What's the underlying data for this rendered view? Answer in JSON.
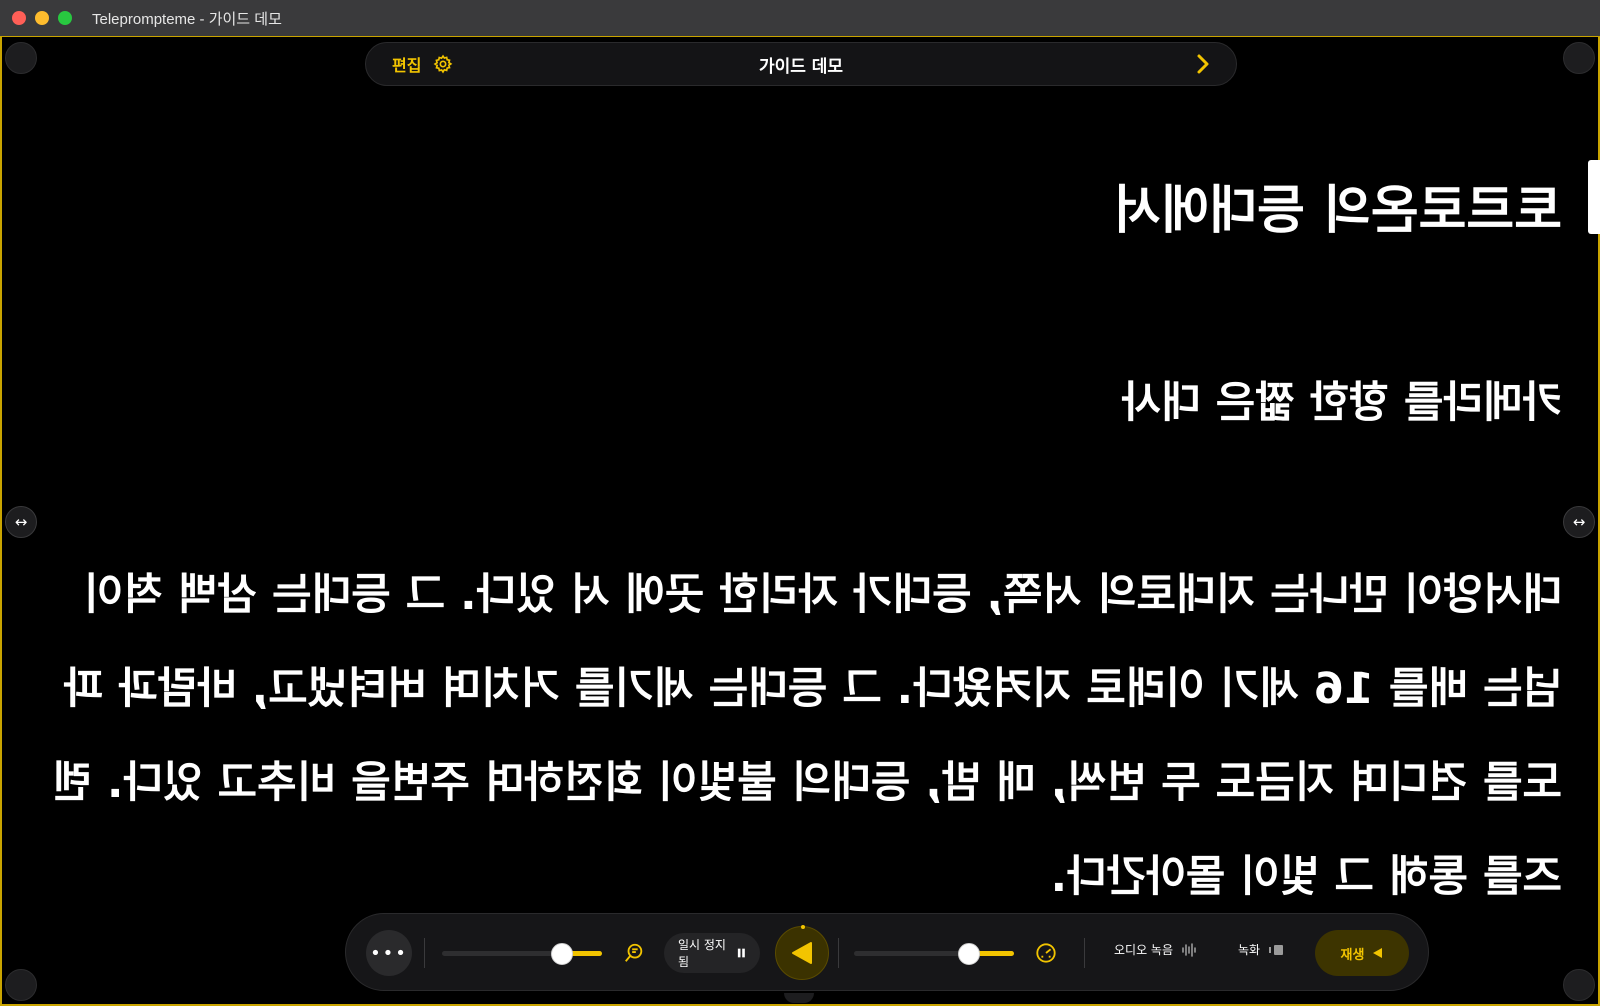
{
  "window": {
    "title": "Teleprompteme - 가이드 데모"
  },
  "topbar": {
    "edit_label": "편집",
    "script_title": "가이드 데모"
  },
  "script": {
    "mirrored": true,
    "heading": "토르로온의 등대에서",
    "subheading": "카메라를 향한 짧은 대사",
    "body": "대서양이 만나는 지대로의 서쪽, 등대가 자리한 곳에 서 있다. 그 등대는 삼백 척이 넘는 배를 16 세기 이래로 지켜왔다. 그 등대는 세기를 거치며 버텨냈고, 바람과 파도를 견디며 지금도 두 번씩, 매 밤, 등대의 불빛이 회전하며 주변을 비추고 있다. 렌즈를 통해 그 빛이 몰아간다."
  },
  "controls": {
    "more_label": "•••",
    "paused_label": "일시 정지됨",
    "audio_record_label": "오디오 녹음",
    "record_label": "녹화",
    "play_label": "재생",
    "zoom_level": 0.75,
    "speed_level": 0.72
  },
  "colors": {
    "accent": "#f2c400",
    "background": "#000000",
    "bar": "#161618"
  }
}
